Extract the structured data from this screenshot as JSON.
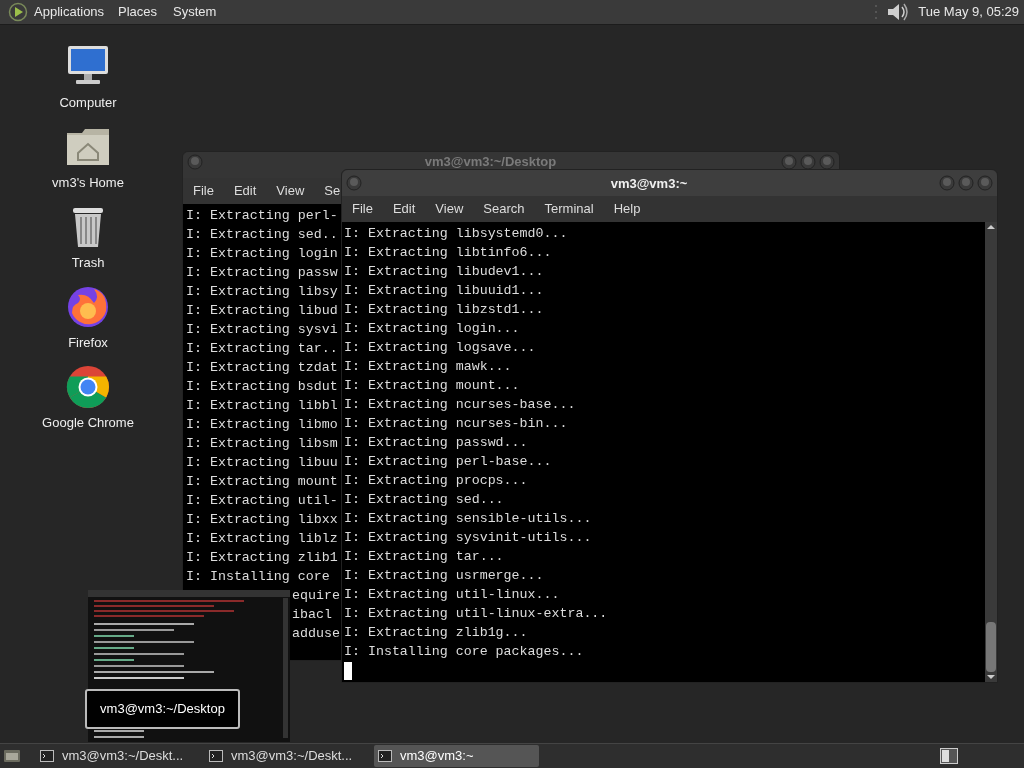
{
  "top_panel": {
    "menus": [
      "Applications",
      "Places",
      "System"
    ],
    "clock": "Tue May 9, 05:29"
  },
  "desktop_icons": [
    {
      "label": "Computer",
      "kind": "computer"
    },
    {
      "label": "vm3's Home",
      "kind": "home"
    },
    {
      "label": "Trash",
      "kind": "trash"
    },
    {
      "label": "Firefox",
      "kind": "firefox"
    },
    {
      "label": "Google Chrome",
      "kind": "chrome"
    }
  ],
  "windows": [
    {
      "title": "vm3@vm3:~/Desktop",
      "active": false,
      "menus": [
        "File",
        "Edit",
        "View",
        "Se"
      ],
      "lines": [
        "I: Extracting perl-",
        "I: Extracting sed..",
        "I: Extracting login",
        "I: Extracting passw",
        "I: Extracting libsy",
        "I: Extracting libud",
        "I: Extracting sysvi",
        "I: Extracting tar..",
        "I: Extracting tzdat",
        "I: Extracting bsdut",
        "I: Extracting libbl",
        "I: Extracting libmo",
        "I: Extracting libsm",
        "I: Extracting libuu",
        "I: Extracting mount",
        "I: Extracting util-",
        "I: Extracting libxx",
        "I: Extracting liblz",
        "I: Extracting zlib1",
        "I: Installing core"
      ],
      "partial_lines": [
        "equire",
        "ibacl",
        "adduse"
      ]
    },
    {
      "title": "vm3@vm3:~",
      "active": true,
      "menus": [
        "File",
        "Edit",
        "View",
        "Search",
        "Terminal",
        "Help"
      ],
      "lines": [
        "I: Extracting libsystemd0...",
        "I: Extracting libtinfo6...",
        "I: Extracting libudev1...",
        "I: Extracting libuuid1...",
        "I: Extracting libzstd1...",
        "I: Extracting login...",
        "I: Extracting logsave...",
        "I: Extracting mawk...",
        "I: Extracting mount...",
        "I: Extracting ncurses-base...",
        "I: Extracting ncurses-bin...",
        "I: Extracting passwd...",
        "I: Extracting perl-base...",
        "I: Extracting procps...",
        "I: Extracting sed...",
        "I: Extracting sensible-utils...",
        "I: Extracting sysvinit-utils...",
        "I: Extracting tar...",
        "I: Extracting usrmerge...",
        "I: Extracting util-linux...",
        "I: Extracting util-linux-extra...",
        "I: Extracting zlib1g...",
        "I: Installing core packages..."
      ]
    }
  ],
  "preview": {
    "title": "vm3@vm3:~/Desktop"
  },
  "taskbar": {
    "tasks": [
      {
        "label": "vm3@vm3:~/Deskt...",
        "selected": false
      },
      {
        "label": "vm3@vm3:~/Deskt...",
        "selected": false
      },
      {
        "label": "vm3@vm3:~",
        "selected": true
      }
    ]
  }
}
